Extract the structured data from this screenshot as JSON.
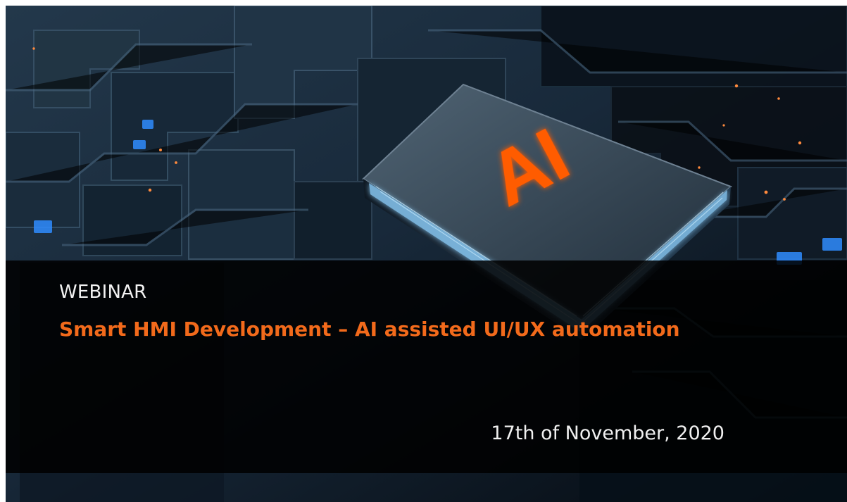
{
  "banner": {
    "label": "WEBINAR",
    "title": "Smart HMI Development – AI assisted UI/UX automation",
    "date": "17th of November, 2020"
  },
  "chip": {
    "mark": "AI"
  },
  "colors": {
    "accent": "#f26a1b",
    "text": "#f0f0f0",
    "background": "#08111a",
    "banner": "#050505"
  },
  "icons": {
    "chip": "ai-chip-icon",
    "circuit": "circuit-board-icon"
  }
}
